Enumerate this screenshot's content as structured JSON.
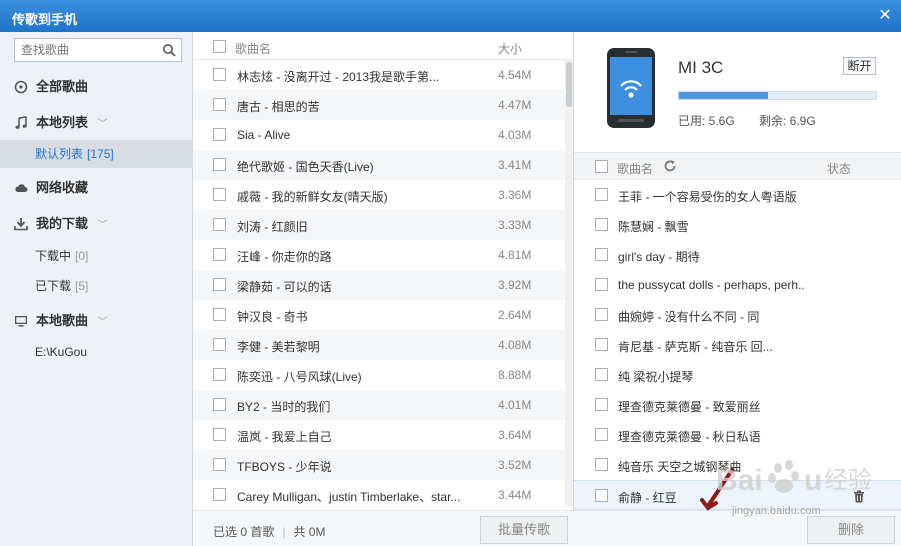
{
  "window": {
    "title": "传歌到手机",
    "close_glyph": "✕"
  },
  "sidebar": {
    "search_placeholder": "查找歌曲",
    "items": [
      {
        "label": "全部歌曲",
        "icon": "disc-icon"
      },
      {
        "label": "本地列表",
        "icon": "music-note-icon",
        "chevron": "﹀"
      },
      {
        "label": "网络收藏",
        "icon": "cloud-icon"
      },
      {
        "label": "我的下载",
        "icon": "download-icon",
        "chevron": "﹀"
      },
      {
        "label": "本地歌曲",
        "icon": "monitor-icon",
        "chevron": "﹀"
      }
    ],
    "sub_items": {
      "default_list": {
        "label": "默认列表",
        "count": "[175]"
      },
      "downloading": {
        "label": "下载中",
        "count": "[0]"
      },
      "downloaded": {
        "label": "已下载",
        "count": "[5]"
      },
      "kugou_path": {
        "label": "E:\\KuGou"
      }
    }
  },
  "songlist": {
    "columns": {
      "name": "歌曲名",
      "size": "大小"
    },
    "rows": [
      {
        "name": "林志炫 - 没离开过 - 2013我是歌手第...",
        "size": "4.54M"
      },
      {
        "name": "唐古 - 相思的苦",
        "size": "4.47M"
      },
      {
        "name": "Sia - Alive",
        "size": "4.03M"
      },
      {
        "name": "绝代歌姬 - 国色天香(Live)",
        "size": "3.41M"
      },
      {
        "name": "戚薇 - 我的新鲜女友(晴天版)",
        "size": "3.36M"
      },
      {
        "name": "刘涛 - 红颜旧",
        "size": "3.33M"
      },
      {
        "name": "汪峰 - 你走你的路",
        "size": "4.81M"
      },
      {
        "name": "梁静茹 - 可以的话",
        "size": "3.92M"
      },
      {
        "name": "钟汉良 - 奇书",
        "size": "2.64M"
      },
      {
        "name": "李健 - 美若黎明",
        "size": "4.08M"
      },
      {
        "name": "陈奕迅 - 八号风球(Live)",
        "size": "8.88M"
      },
      {
        "name": "BY2 - 当时的我们",
        "size": "4.01M"
      },
      {
        "name": "温岚 - 我爱上自己",
        "size": "3.64M"
      },
      {
        "name": "TFBOYS - 少年说",
        "size": "3.52M"
      },
      {
        "name": "Carey Mulligan、justin Timberlake、star...",
        "size": "3.44M"
      }
    ],
    "footer": {
      "selected": "已选 0 首歌",
      "total": "共 0M",
      "batch_button": "批量传歌"
    }
  },
  "phone": {
    "device_name": "MI 3C",
    "disconnect_label": "断开",
    "storage_used_fraction": 0.45,
    "used_label": "已用: 5.6G",
    "remain_label": "剩余: 6.9G",
    "columns": {
      "name": "歌曲名",
      "status": "状态"
    },
    "rows": [
      {
        "name": "王菲 - 一个容易受伤的女人粤语版"
      },
      {
        "name": "陈慧娴 - 飘雪"
      },
      {
        "name": "girl's day - 期待"
      },
      {
        "name": "the pussycat dolls - perhaps, perh.."
      },
      {
        "name": "曲婉婷 - 没有什么不同 - 同"
      },
      {
        "name": "肯尼基 - 萨克斯 - 纯音乐 回..."
      },
      {
        "name": "纯 梁祝小提琴"
      },
      {
        "name": "理查德克莱德曼 - 致爱丽丝"
      },
      {
        "name": "理查德克莱德曼 - 秋日私语"
      },
      {
        "name": "纯音乐 天空之城钢琴曲"
      },
      {
        "name": "俞静 - 红豆"
      }
    ],
    "delete_button": "删除"
  },
  "watermark": {
    "text": "Baidu经验",
    "url": "jingyan.baidu.com"
  }
}
